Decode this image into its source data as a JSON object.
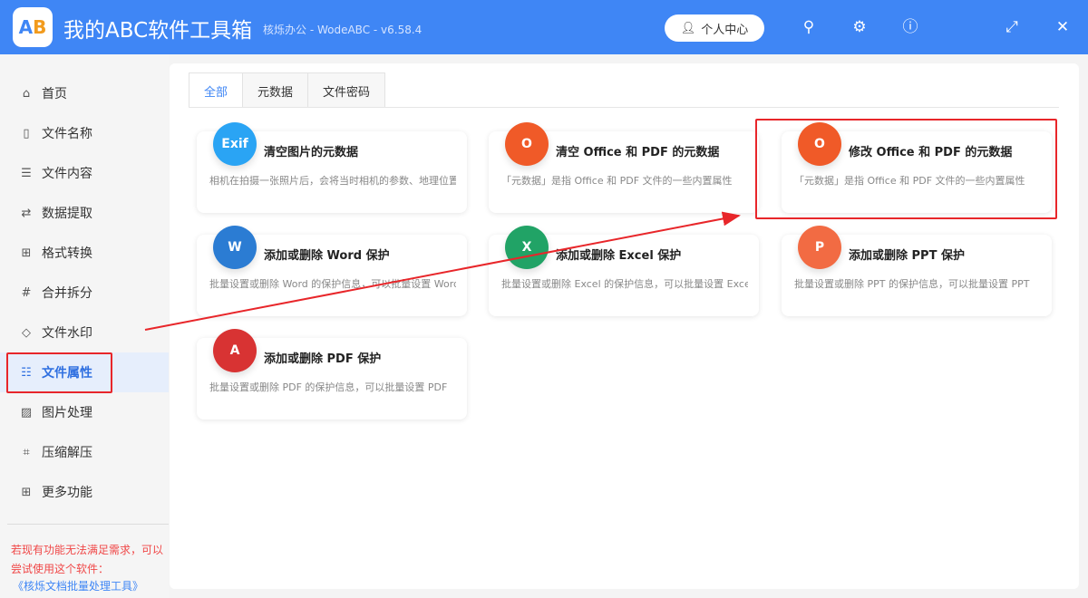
{
  "header": {
    "logo_text": "AB",
    "title": "我的ABC软件工具箱",
    "subtitle": "核烁办公 - WodeABC - v6.58.4",
    "user_button": "个人中心"
  },
  "sidebar": {
    "items": [
      {
        "label": "首页",
        "icon": "home-icon",
        "glyph": "⌂"
      },
      {
        "label": "文件名称",
        "icon": "file-icon",
        "glyph": "▯"
      },
      {
        "label": "文件内容",
        "icon": "content-icon",
        "glyph": "☰"
      },
      {
        "label": "数据提取",
        "icon": "extract-icon",
        "glyph": "⇄"
      },
      {
        "label": "格式转换",
        "icon": "convert-icon",
        "glyph": "⊞"
      },
      {
        "label": "合并拆分",
        "icon": "merge-icon",
        "glyph": "#"
      },
      {
        "label": "文件水印",
        "icon": "watermark-icon",
        "glyph": "◇"
      },
      {
        "label": "文件属性",
        "icon": "properties-icon",
        "glyph": "☷"
      },
      {
        "label": "图片处理",
        "icon": "image-icon",
        "glyph": "▨"
      },
      {
        "label": "压缩解压",
        "icon": "compress-icon",
        "glyph": "⌗"
      },
      {
        "label": "更多功能",
        "icon": "more-icon",
        "glyph": "⊞"
      }
    ],
    "active_index": 7,
    "note_line1": "若现有功能无法满足需求，可以",
    "note_line2": "尝试使用这个软件：",
    "link": "《核烁文档批量处理工具》"
  },
  "tabs": [
    "全部",
    "元数据",
    "文件密码"
  ],
  "cards": [
    {
      "title": "清空图片的元数据",
      "desc": "相机在拍摄一张照片后，会将当时相机的参数、地理位置等信息",
      "icon": "exif-icon",
      "glyph": "Exif",
      "color": "#2aa4f4"
    },
    {
      "title": "清空 Office 和 PDF 的元数据",
      "desc": "「元数据」是指 Office 和 PDF 文件的一些内置属性",
      "icon": "office-clean-icon",
      "glyph": "O",
      "color": "#f05a28"
    },
    {
      "title": "修改 Office 和 PDF 的元数据",
      "desc": "「元数据」是指 Office 和 PDF 文件的一些内置属性",
      "icon": "office-edit-icon",
      "glyph": "O",
      "color": "#f05a28"
    },
    {
      "title": "添加或删除 Word 保护",
      "desc": "批量设置或删除 Word 的保护信息，可以批量设置 Word",
      "icon": "word-lock-icon",
      "glyph": "W",
      "color": "#2b7cd3"
    },
    {
      "title": "添加或删除 Excel 保护",
      "desc": "批量设置或删除 Excel 的保护信息，可以批量设置 Excel",
      "icon": "excel-lock-icon",
      "glyph": "X",
      "color": "#21a366"
    },
    {
      "title": "添加或删除 PPT 保护",
      "desc": "批量设置或删除 PPT 的保护信息，可以批量设置 PPT",
      "icon": "ppt-lock-icon",
      "glyph": "P",
      "color": "#f26b43"
    },
    {
      "title": "添加或删除 PDF 保护",
      "desc": "批量设置或删除 PDF 的保护信息，可以批量设置 PDF",
      "icon": "pdf-lock-icon",
      "glyph": "A",
      "color": "#d83333"
    }
  ]
}
